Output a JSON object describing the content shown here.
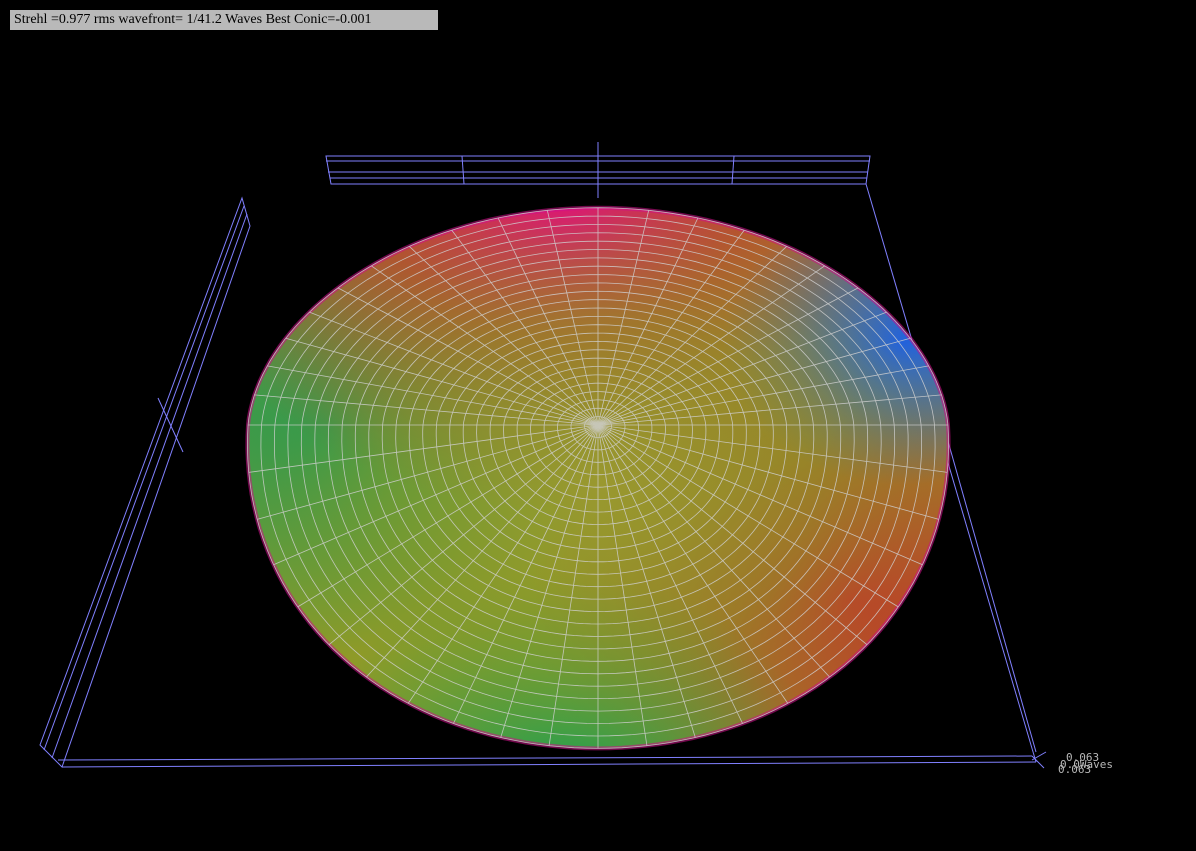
{
  "info": {
    "text": "Strehl =0.977 rms wavefront= 1/41.2 Waves Best Conic=-0.001"
  },
  "scale": {
    "max": "0.063",
    "unit": "Waves",
    "min": "0.063"
  },
  "colors": {
    "background": "#000000",
    "frame": "#8080ff",
    "mesh": "#d0d0d0",
    "surface_low": "#ff00a0",
    "surface_mid": "#88aa20",
    "surface_high": "#20a060"
  },
  "icons": {
    "surface": "wavefront-surface-mesh",
    "frame": "bounding-box-wireframe"
  }
}
